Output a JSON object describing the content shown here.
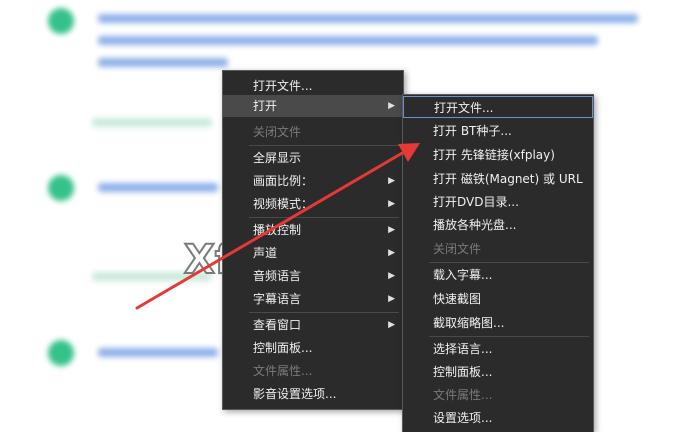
{
  "menu_main": {
    "items": [
      {
        "label": "打开文件...",
        "arrow": "",
        "disabled": false
      },
      {
        "label": "打开",
        "arrow": "▶",
        "disabled": false
      },
      {
        "label": "关闭文件",
        "arrow": "",
        "disabled": true
      },
      {
        "label": "全屏显示",
        "arrow": "",
        "disabled": false
      },
      {
        "label": "画面比例：",
        "arrow": "▶",
        "disabled": false
      },
      {
        "label": "视频模式：",
        "arrow": "▶",
        "disabled": false
      },
      {
        "label": "播放控制",
        "arrow": "▶",
        "disabled": false
      },
      {
        "label": "声道",
        "arrow": "▶",
        "disabled": false
      },
      {
        "label": "音频语言",
        "arrow": "▶",
        "disabled": false
      },
      {
        "label": "字幕语言",
        "arrow": "▶",
        "disabled": false
      },
      {
        "label": "查看窗口",
        "arrow": "▶",
        "disabled": false
      },
      {
        "label": "控制面板...",
        "arrow": "",
        "disabled": false
      },
      {
        "label": "文件属性...",
        "arrow": "",
        "disabled": true
      },
      {
        "label": "影音设置选项...",
        "arrow": "",
        "disabled": false
      }
    ]
  },
  "menu_open": {
    "items": [
      {
        "label": "打开文件...",
        "disabled": false
      },
      {
        "label": "打开 BT种子...",
        "disabled": false
      },
      {
        "label": "打开 先锋链接(xfplay)",
        "disabled": false
      },
      {
        "label": "打开 磁铁(Magnet) 或 URL",
        "disabled": false
      },
      {
        "label": "打开DVD目录...",
        "disabled": false
      },
      {
        "label": "播放各种光盘...",
        "disabled": false
      },
      {
        "label": "关闭文件",
        "disabled": true
      },
      {
        "label": "载入字幕...",
        "disabled": false
      },
      {
        "label": "快速截图",
        "disabled": false
      },
      {
        "label": "截取缩略图...",
        "disabled": false
      },
      {
        "label": "选择语言...",
        "disabled": false
      },
      {
        "label": "控制面板...",
        "disabled": false
      },
      {
        "label": "文件属性...",
        "disabled": true
      },
      {
        "label": "设置选项...",
        "disabled": false
      }
    ]
  },
  "background": {
    "logo": "Xf"
  },
  "colors": {
    "menu_bg": "#2b2b2b",
    "highlight_box": "#6b8fd6",
    "arrow": "#e53935",
    "step_circle": "#35c28a"
  }
}
